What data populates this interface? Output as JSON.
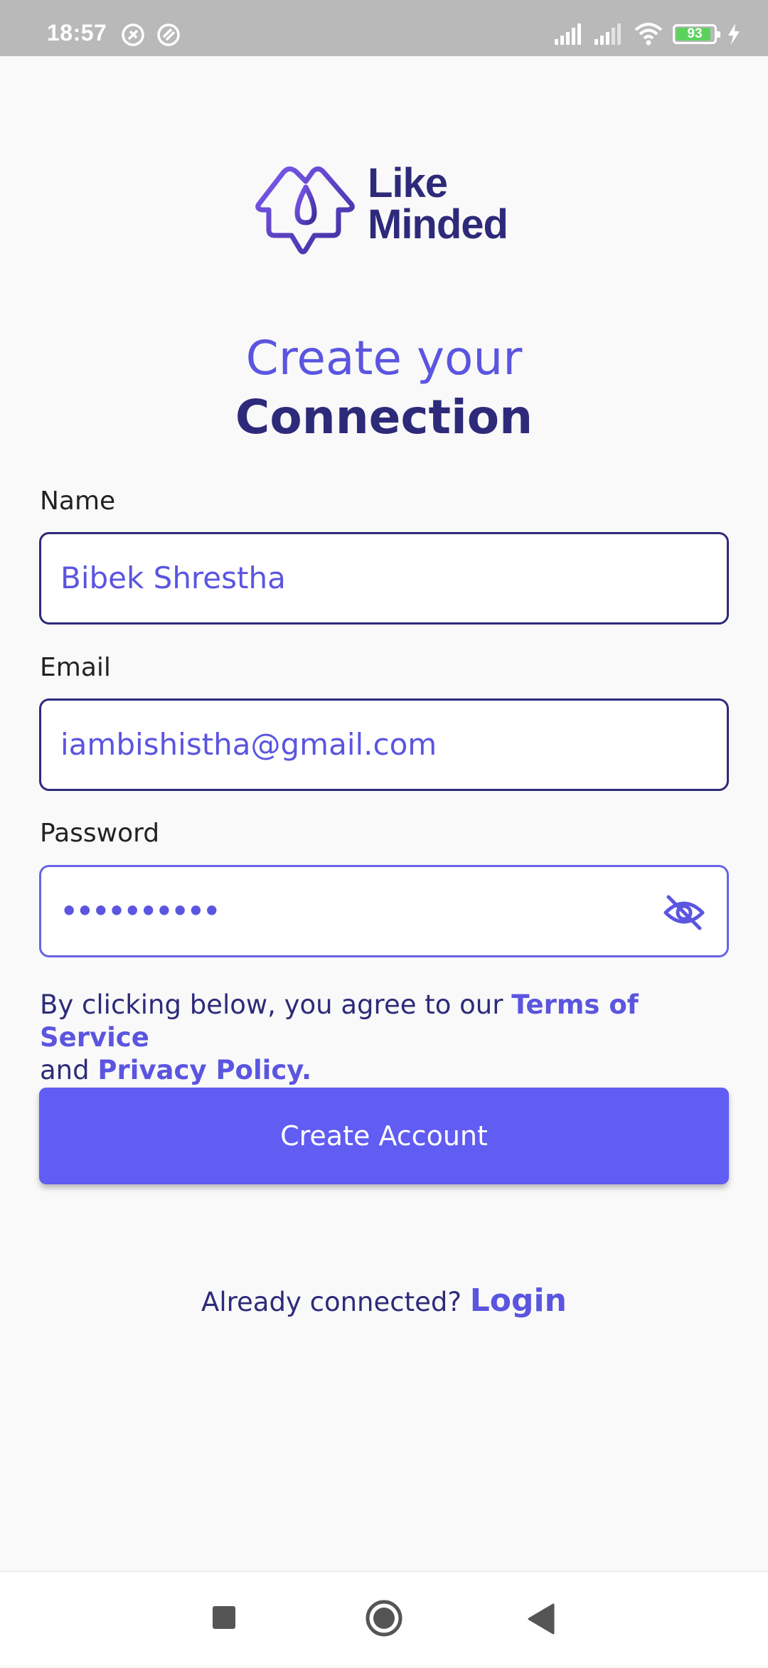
{
  "status_bar": {
    "time": "18:57",
    "battery": "93",
    "battery_level": 0.93,
    "icons": [
      "notification-icon",
      "notification-icon",
      "signal-icon",
      "signal-icon",
      "wifi-icon",
      "battery-icon",
      "charging-icon"
    ]
  },
  "logo": {
    "line1": "Like",
    "line2": "Minded",
    "icon": "likeminded-logo-icon"
  },
  "heading": {
    "line1": "Create your",
    "line2": "Connection"
  },
  "form": {
    "name_label": "Name",
    "name_value": "Bibek Shrestha",
    "email_label": "Email",
    "email_value": "iambishistha@gmail.com",
    "password_label": "Password",
    "password_value": "••••••••••",
    "password_toggle_icon": "eye-off-icon"
  },
  "terms": {
    "prefix": "By clicking below, you agree to our ",
    "terms_link": "Terms of Service",
    "middle": "and ",
    "privacy_link": "Privacy Policy."
  },
  "cta": {
    "label": "Create Account"
  },
  "login": {
    "prompt": "Already connected? ",
    "link": "Login"
  },
  "nav_bar": {
    "icons": [
      "recents-square-icon",
      "home-circle-icon",
      "back-triangle-icon"
    ]
  },
  "colors": {
    "accent": "#615cf2",
    "text_accent": "#5b55e0",
    "dark_navy": "#2e2a7a",
    "status_bar": "#b9b9b9",
    "background": "#f9f9f9"
  }
}
